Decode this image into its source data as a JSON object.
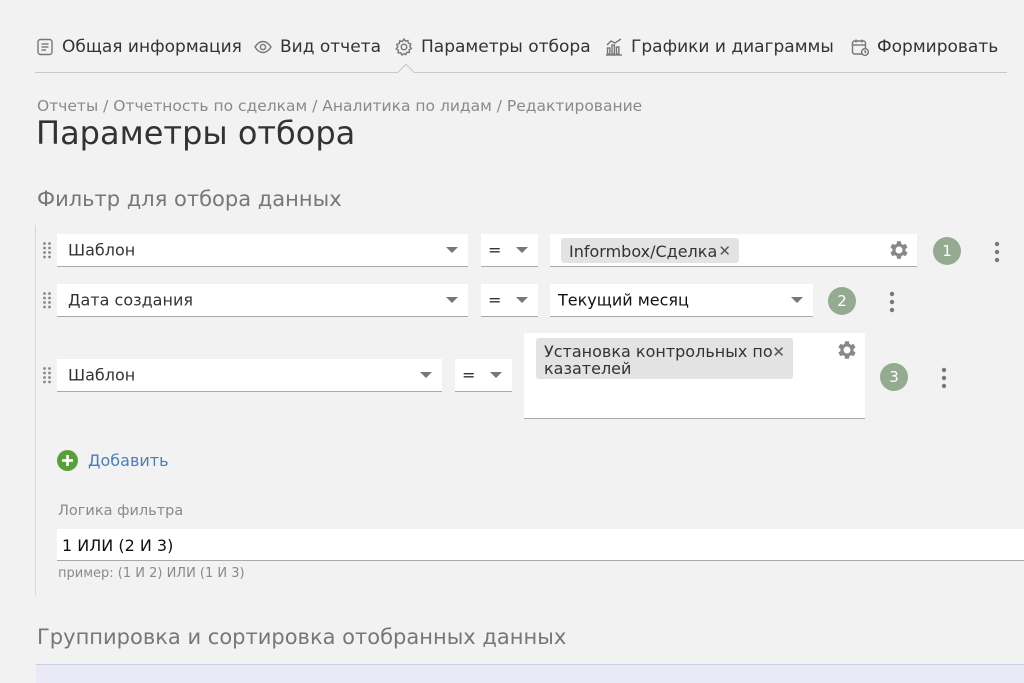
{
  "tabs": [
    {
      "label": "Общая информация",
      "icon": "document-icon"
    },
    {
      "label": "Вид отчета",
      "icon": "eye-icon"
    },
    {
      "label": "Параметры отбора",
      "icon": "gear-icon",
      "active": true
    },
    {
      "label": "Графики и диаграммы",
      "icon": "chart-icon"
    },
    {
      "label": "Формировать",
      "icon": "calendar-icon"
    }
  ],
  "breadcrumb": "Отчеты / Отчетность по сделкам / Аналитика по лидам / Редактирование",
  "page_title": "Параметры отбора",
  "filter_section_title": "Фильтр для отбора данных",
  "filters": [
    {
      "number": "1",
      "field": "Шаблон",
      "operator": "=",
      "chip": "Informbox/Сделка"
    },
    {
      "number": "2",
      "field": "Дата создания",
      "operator": "=",
      "value": "Текущий месяц"
    },
    {
      "number": "3",
      "field": "Шаблон",
      "operator": "=",
      "chip_line1": "Установка контрольных по",
      "chip_line2": "казателей"
    }
  ],
  "add_label": "Добавить",
  "logic": {
    "label": "Логика фильтра",
    "value": "1 ИЛИ (2 И 3)",
    "hint": "пример: (1 И 2) ИЛИ (1 И 3)"
  },
  "group_section_title": "Группировка и сортировка отобранных данных",
  "colors": {
    "accent_link": "#4a7fb5",
    "number_badge": "#94ab92",
    "add_icon": "#5a9e3a"
  }
}
